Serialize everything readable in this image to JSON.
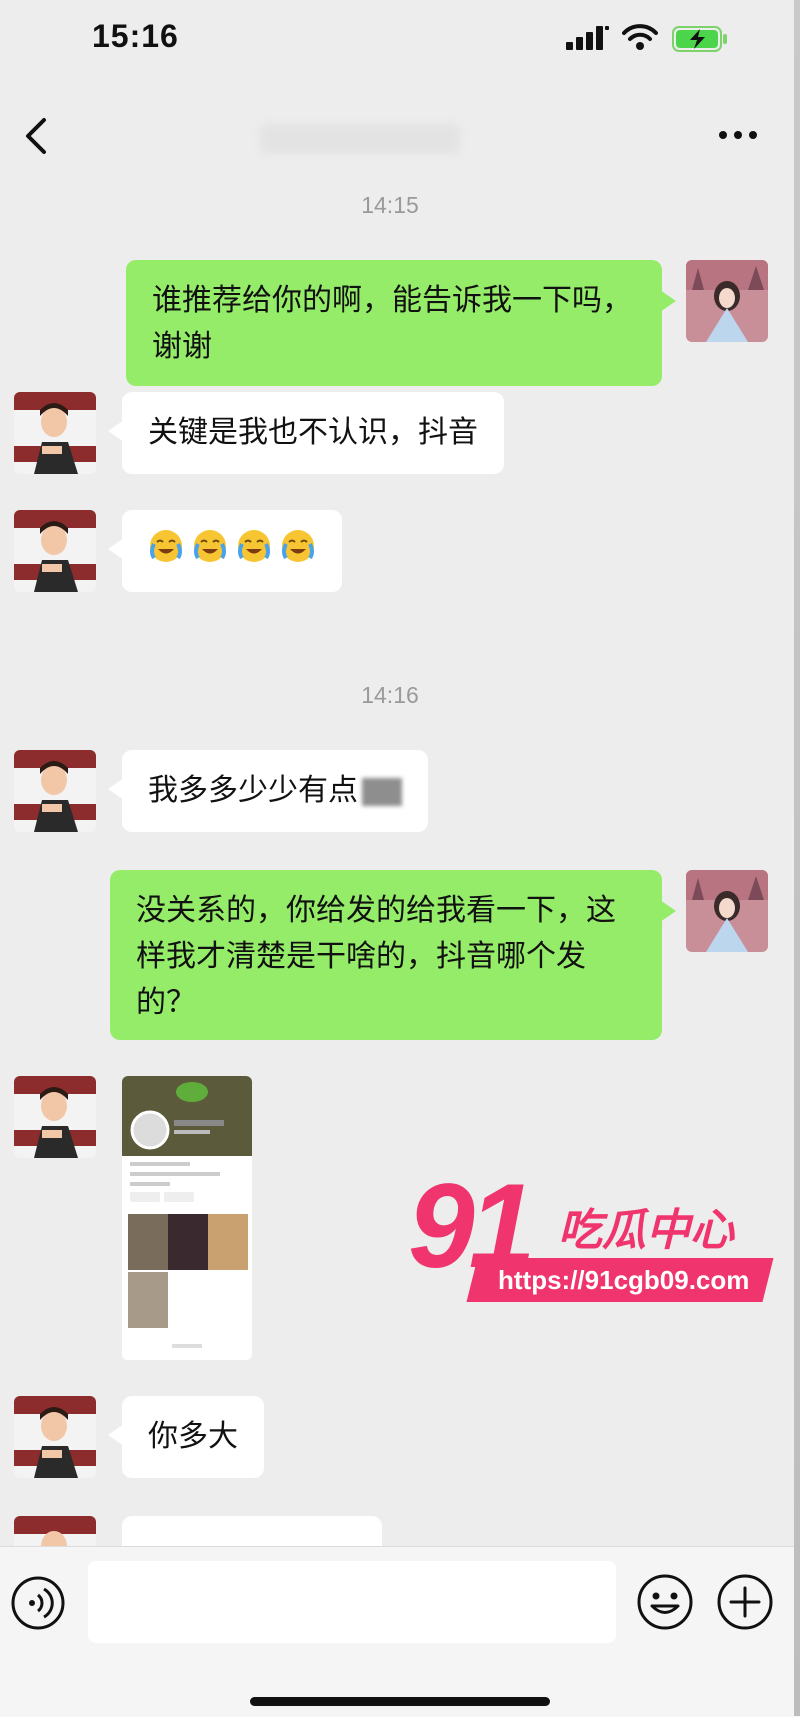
{
  "status_bar": {
    "time": "15:16"
  },
  "nav": {
    "title": ""
  },
  "messages": [
    {
      "type": "timestamp",
      "text": "14:15"
    },
    {
      "type": "text",
      "from": "me",
      "text": "谁推荐给你的啊，能告诉我一下吗，谢谢"
    },
    {
      "type": "text",
      "from": "other",
      "text": "关键是我也不认识，抖音"
    },
    {
      "type": "emoji",
      "from": "other",
      "emoji_name": "cry-laugh-emoji",
      "count": 4
    },
    {
      "type": "timestamp",
      "text": "14:16"
    },
    {
      "type": "text",
      "from": "other",
      "text": "我多多少少有点"
    },
    {
      "type": "text",
      "from": "me",
      "text": "没关系的，你给发的给我看一下，这样我才清楚是干啥的，抖音哪个发的？"
    },
    {
      "type": "image",
      "from": "other",
      "image_desc": "profile-screenshot"
    },
    {
      "type": "text",
      "from": "other",
      "text": "你多大"
    }
  ],
  "watermark": {
    "number": "91",
    "name": "吃瓜中心",
    "url": "https://91cgb09.com"
  },
  "colors": {
    "background": "#ededed",
    "my_bubble": "#95ec69",
    "their_bubble": "#ffffff",
    "watermark": "#f0356e"
  }
}
